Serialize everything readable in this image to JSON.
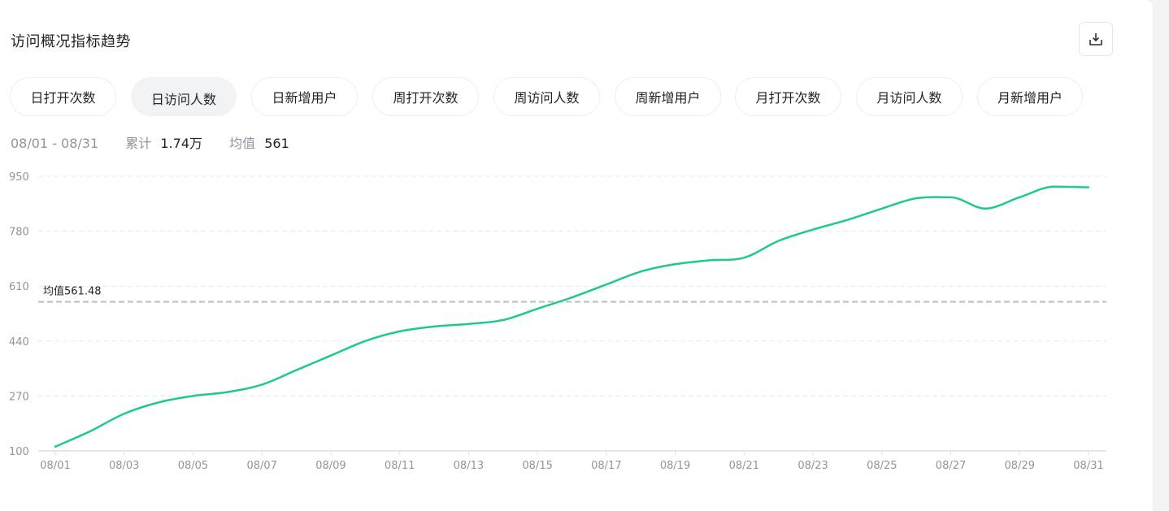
{
  "title": "访问概况指标趋势",
  "export_button": {
    "icon": "download-icon"
  },
  "tabs": [
    {
      "label": "日打开次数",
      "selected": false
    },
    {
      "label": "日访问人数",
      "selected": true
    },
    {
      "label": "日新增用户",
      "selected": false
    },
    {
      "label": "周打开次数",
      "selected": false
    },
    {
      "label": "周访问人数",
      "selected": false
    },
    {
      "label": "周新增用户",
      "selected": false
    },
    {
      "label": "月打开次数",
      "selected": false
    },
    {
      "label": "月访问人数",
      "selected": false
    },
    {
      "label": "月新增用户",
      "selected": false
    }
  ],
  "summary": {
    "date_range": "08/01 - 08/31",
    "total_label": "累计",
    "total_value": "1.74万",
    "avg_label": "均值",
    "avg_value": "561"
  },
  "colors": {
    "line": "#1ec88f",
    "grid": "#e6e8eb",
    "axis": "#dcdee2",
    "avg_line": "#b8bbc0",
    "tick_text": "#8f959e"
  },
  "chart_data": {
    "type": "line",
    "x": [
      "08/01",
      "08/02",
      "08/03",
      "08/04",
      "08/05",
      "08/06",
      "08/07",
      "08/08",
      "08/09",
      "08/10",
      "08/11",
      "08/12",
      "08/13",
      "08/14",
      "08/15",
      "08/16",
      "08/17",
      "08/18",
      "08/19",
      "08/20",
      "08/21",
      "08/22",
      "08/23",
      "08/24",
      "08/25",
      "08/26",
      "08/27",
      "08/28",
      "08/29",
      "08/30",
      "08/31"
    ],
    "x_tick_labels": [
      "08/01",
      "08/03",
      "08/05",
      "08/07",
      "08/09",
      "08/11",
      "08/13",
      "08/15",
      "08/17",
      "08/19",
      "08/21",
      "08/23",
      "08/25",
      "08/27",
      "08/29",
      "08/31"
    ],
    "series": [
      {
        "values": [
          113,
          160,
          215,
          250,
          270,
          282,
          305,
          350,
          395,
          440,
          470,
          485,
          493,
          505,
          540,
          575,
          615,
          655,
          678,
          690,
          698,
          750,
          785,
          815,
          850,
          882,
          885,
          850,
          885,
          918,
          916
        ]
      }
    ],
    "ylim": [
      100,
      950
    ],
    "y_ticks": [
      100,
      270,
      440,
      610,
      780,
      950
    ],
    "grid": true,
    "average_line": {
      "label": "均值561.48",
      "value": 561.48
    }
  }
}
